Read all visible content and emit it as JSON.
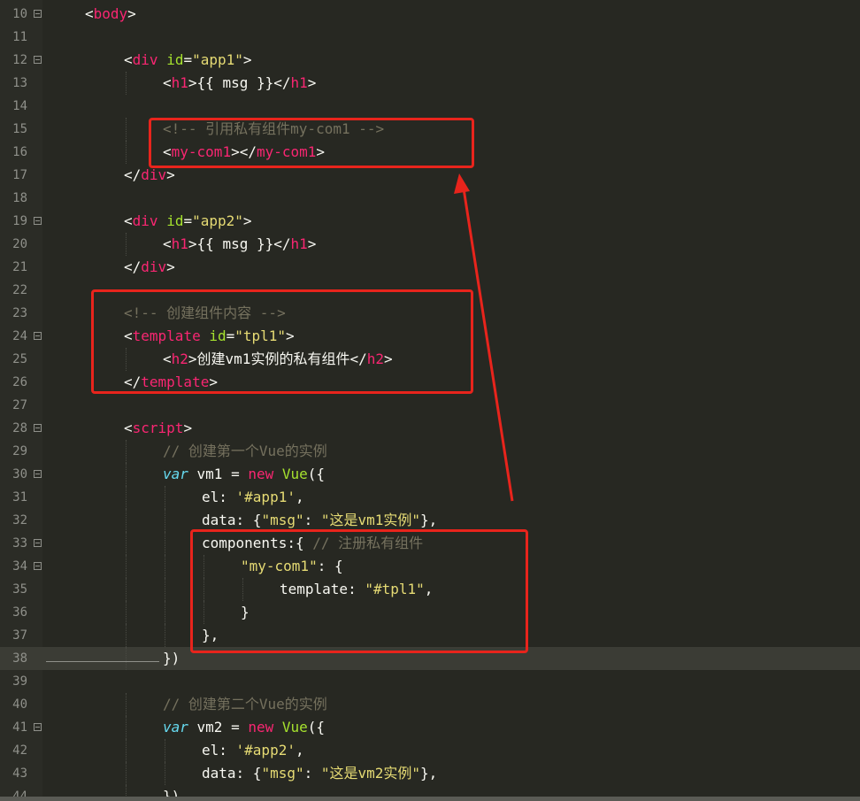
{
  "editor": {
    "lines": [
      {
        "n": "10",
        "fold": true,
        "indent": 0,
        "tokens": [
          [
            "p",
            "<"
          ],
          [
            "tag",
            "body"
          ],
          [
            "p",
            ">"
          ]
        ]
      },
      {
        "n": "11",
        "fold": false,
        "indent": 0,
        "tokens": []
      },
      {
        "n": "12",
        "fold": true,
        "indent": 1,
        "tokens": [
          [
            "p",
            "<"
          ],
          [
            "tag",
            "div"
          ],
          [
            "p",
            " "
          ],
          [
            "attr",
            "id"
          ],
          [
            "p",
            "="
          ],
          [
            "str",
            "\"app1\""
          ],
          [
            "p",
            ">"
          ]
        ]
      },
      {
        "n": "13",
        "fold": false,
        "indent": 2,
        "tokens": [
          [
            "p",
            "<"
          ],
          [
            "tag",
            "h1"
          ],
          [
            "p",
            ">{{ msg }}</"
          ],
          [
            "tag",
            "h1"
          ],
          [
            "p",
            ">"
          ]
        ]
      },
      {
        "n": "14",
        "fold": false,
        "indent": 0,
        "tokens": []
      },
      {
        "n": "15",
        "fold": false,
        "indent": 2,
        "tokens": [
          [
            "cmt",
            "<!-- 引用私有组件my-com1 -->"
          ]
        ]
      },
      {
        "n": "16",
        "fold": false,
        "indent": 2,
        "tokens": [
          [
            "p",
            "<"
          ],
          [
            "tag",
            "my-com1"
          ],
          [
            "p",
            "></"
          ],
          [
            "tag",
            "my-com1"
          ],
          [
            "p",
            ">"
          ]
        ]
      },
      {
        "n": "17",
        "fold": false,
        "indent": 1,
        "tokens": [
          [
            "p",
            "</"
          ],
          [
            "tag",
            "div"
          ],
          [
            "p",
            ">"
          ]
        ]
      },
      {
        "n": "18",
        "fold": false,
        "indent": 0,
        "tokens": []
      },
      {
        "n": "19",
        "fold": true,
        "indent": 1,
        "tokens": [
          [
            "p",
            "<"
          ],
          [
            "tag",
            "div"
          ],
          [
            "p",
            " "
          ],
          [
            "attr",
            "id"
          ],
          [
            "p",
            "="
          ],
          [
            "str",
            "\"app2\""
          ],
          [
            "p",
            ">"
          ]
        ]
      },
      {
        "n": "20",
        "fold": false,
        "indent": 2,
        "tokens": [
          [
            "p",
            "<"
          ],
          [
            "tag",
            "h1"
          ],
          [
            "p",
            ">{{ msg }}</"
          ],
          [
            "tag",
            "h1"
          ],
          [
            "p",
            ">"
          ]
        ]
      },
      {
        "n": "21",
        "fold": false,
        "indent": 1,
        "tokens": [
          [
            "p",
            "</"
          ],
          [
            "tag",
            "div"
          ],
          [
            "p",
            ">"
          ]
        ]
      },
      {
        "n": "22",
        "fold": false,
        "indent": 0,
        "tokens": []
      },
      {
        "n": "23",
        "fold": false,
        "indent": 1,
        "tokens": [
          [
            "cmt",
            "<!-- 创建组件内容 -->"
          ]
        ]
      },
      {
        "n": "24",
        "fold": true,
        "indent": 1,
        "tokens": [
          [
            "p",
            "<"
          ],
          [
            "tag",
            "template"
          ],
          [
            "p",
            " "
          ],
          [
            "attr",
            "id"
          ],
          [
            "p",
            "="
          ],
          [
            "str",
            "\"tpl1\""
          ],
          [
            "p",
            ">"
          ]
        ]
      },
      {
        "n": "25",
        "fold": false,
        "indent": 2,
        "tokens": [
          [
            "p",
            "<"
          ],
          [
            "tag",
            "h2"
          ],
          [
            "p",
            ">创建vm1实例的私有组件</"
          ],
          [
            "tag",
            "h2"
          ],
          [
            "p",
            ">"
          ]
        ]
      },
      {
        "n": "26",
        "fold": false,
        "indent": 1,
        "tokens": [
          [
            "p",
            "</"
          ],
          [
            "tag",
            "template"
          ],
          [
            "p",
            ">"
          ]
        ]
      },
      {
        "n": "27",
        "fold": false,
        "indent": 0,
        "tokens": []
      },
      {
        "n": "28",
        "fold": true,
        "indent": 1,
        "tokens": [
          [
            "p",
            "<"
          ],
          [
            "tag",
            "script"
          ],
          [
            "p",
            ">"
          ]
        ]
      },
      {
        "n": "29",
        "fold": false,
        "indent": 2,
        "tokens": [
          [
            "cmt",
            "// 创建第一个Vue的实例"
          ]
        ]
      },
      {
        "n": "30",
        "fold": true,
        "indent": 2,
        "tokens": [
          [
            "var",
            "var"
          ],
          [
            "p",
            " vm1 = "
          ],
          [
            "kw",
            "new"
          ],
          [
            "p",
            " "
          ],
          [
            "cls",
            "Vue"
          ],
          [
            "p",
            "({"
          ]
        ]
      },
      {
        "n": "31",
        "fold": false,
        "indent": 3,
        "tokens": [
          [
            "p",
            "el: "
          ],
          [
            "str",
            "'#app1'"
          ],
          [
            "p",
            ","
          ]
        ]
      },
      {
        "n": "32",
        "fold": false,
        "indent": 3,
        "tokens": [
          [
            "p",
            "data: {"
          ],
          [
            "str",
            "\"msg\""
          ],
          [
            "p",
            ": "
          ],
          [
            "str",
            "\"这是vm1实例\""
          ],
          [
            "p",
            "},"
          ]
        ]
      },
      {
        "n": "33",
        "fold": true,
        "indent": 3,
        "tokens": [
          [
            "p",
            "components:{ "
          ],
          [
            "cmt",
            "// 注册私有组件"
          ]
        ]
      },
      {
        "n": "34",
        "fold": true,
        "indent": 4,
        "tokens": [
          [
            "str",
            "\"my-com1\""
          ],
          [
            "p",
            ": {"
          ]
        ]
      },
      {
        "n": "35",
        "fold": false,
        "indent": 5,
        "tokens": [
          [
            "p",
            "template: "
          ],
          [
            "str",
            "\"#tpl1\""
          ],
          [
            "p",
            ","
          ]
        ]
      },
      {
        "n": "36",
        "fold": false,
        "indent": 4,
        "tokens": [
          [
            "p",
            "}"
          ]
        ]
      },
      {
        "n": "37",
        "fold": false,
        "indent": 3,
        "tokens": [
          [
            "p",
            "},"
          ]
        ]
      },
      {
        "n": "38",
        "fold": false,
        "indent": 2,
        "current": true,
        "tokens": [
          [
            "p",
            "})"
          ]
        ]
      },
      {
        "n": "39",
        "fold": false,
        "indent": 0,
        "tokens": []
      },
      {
        "n": "40",
        "fold": false,
        "indent": 2,
        "tokens": [
          [
            "cmt",
            "// 创建第二个Vue的实例"
          ]
        ]
      },
      {
        "n": "41",
        "fold": true,
        "indent": 2,
        "tokens": [
          [
            "var",
            "var"
          ],
          [
            "p",
            " vm2 = "
          ],
          [
            "kw",
            "new"
          ],
          [
            "p",
            " "
          ],
          [
            "cls",
            "Vue"
          ],
          [
            "p",
            "({"
          ]
        ]
      },
      {
        "n": "42",
        "fold": false,
        "indent": 3,
        "tokens": [
          [
            "p",
            "el: "
          ],
          [
            "str",
            "'#app2'"
          ],
          [
            "p",
            ","
          ]
        ]
      },
      {
        "n": "43",
        "fold": false,
        "indent": 3,
        "tokens": [
          [
            "p",
            "data: {"
          ],
          [
            "str",
            "\"msg\""
          ],
          [
            "p",
            ": "
          ],
          [
            "str",
            "\"这是vm2实例\""
          ],
          [
            "p",
            "},"
          ]
        ]
      },
      {
        "n": "44",
        "fold": false,
        "indent": 2,
        "tokens": [
          [
            "p",
            "})"
          ]
        ]
      }
    ]
  },
  "annotation": {
    "color": "#e8241c"
  }
}
